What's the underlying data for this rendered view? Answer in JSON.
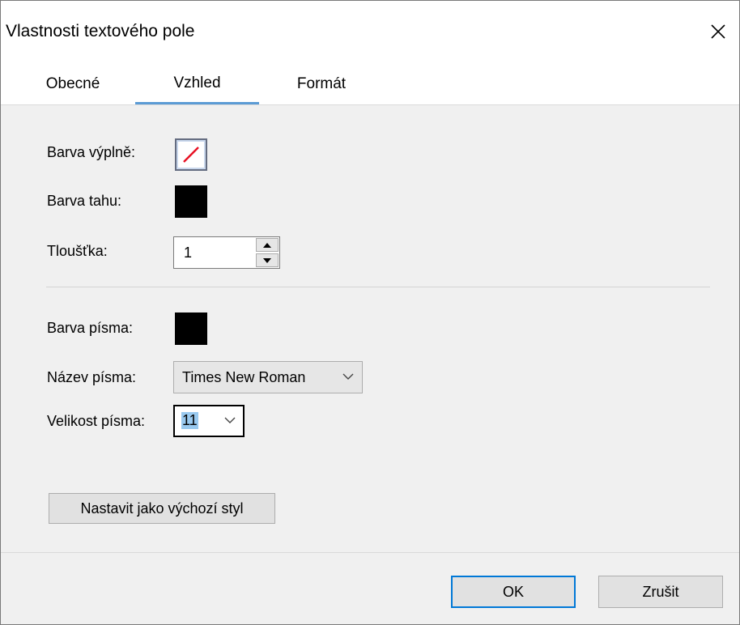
{
  "window": {
    "title": "Vlastnosti textového pole",
    "close_icon": "close-icon"
  },
  "tabs": [
    {
      "label": "Obecné",
      "active": false
    },
    {
      "label": "Vzhled",
      "active": true
    },
    {
      "label": "Formát",
      "active": false
    }
  ],
  "appearance": {
    "fill_color_label": "Barva výplně:",
    "fill_color": "none",
    "stroke_color_label": "Barva tahu:",
    "stroke_color": "#000000",
    "thickness_label": "Tloušťka:",
    "thickness_value": "1"
  },
  "font": {
    "color_label": "Barva písma:",
    "color": "#000000",
    "name_label": "Název písma:",
    "name_value": "Times New Roman",
    "size_label": "Velikost písma:",
    "size_value": "11"
  },
  "set_default_button": "Nastavit jako výchozí styl",
  "footer": {
    "ok_label": "OK",
    "cancel_label": "Zrušit"
  },
  "colors": {
    "accent": "#5b9bd5",
    "focus_border": "#0078d7",
    "selection": "#99c9ef",
    "no_fill_slash": "#e81123"
  }
}
